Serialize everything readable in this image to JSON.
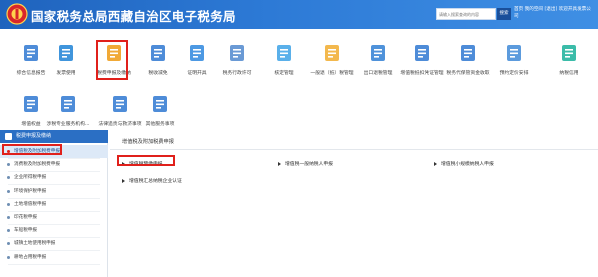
{
  "header": {
    "title": "国家税务总局西藏自治区电子税务局",
    "search_placeholder": "请输入搜索查询的内容",
    "search_button": "搜索",
    "links": "首页  我的空间  [退出]  欢迎开具发票公司"
  },
  "colors": {
    "header_bg": "#2470cc",
    "accent": "#2b6fc4",
    "highlight": "#e0201b"
  },
  "toolbar": {
    "items": [
      {
        "label": "综合信息报告",
        "icon": "info-report-icon",
        "color": "#3b7fd4"
      },
      {
        "label": "发票使用",
        "icon": "invoice-use-icon",
        "color": "#2b8ad8"
      },
      {
        "label": "税费申报及缴纳",
        "icon": "tax-filing-icon",
        "color": "#f0a020"
      },
      {
        "label": "税收减免",
        "icon": "tax-reduction-icon",
        "color": "#3b7fd4"
      },
      {
        "label": "证明开具",
        "icon": "certificate-icon",
        "color": "#3a8ee0"
      },
      {
        "label": "税务行政许可",
        "icon": "admin-license-icon",
        "color": "#5a8fd0"
      },
      {
        "label": "核定管理",
        "icon": "assessment-icon",
        "color": "#48a7e8"
      },
      {
        "label": "一般退（抵）税管理",
        "icon": "tax-refund-icon",
        "color": "#f2b03a"
      },
      {
        "label": "出口退税管理",
        "icon": "export-refund-icon",
        "color": "#3c86d6"
      },
      {
        "label": "增值税抵扣凭证管理",
        "icon": "vat-deduction-icon",
        "color": "#3b7fd4"
      },
      {
        "label": "税务代保管资金收取",
        "icon": "custody-fund-icon",
        "color": "#3b7fd4"
      },
      {
        "label": "预约定价安排",
        "icon": "pricing-icon",
        "color": "#4a90d9"
      },
      {
        "label": "纳税信用",
        "icon": "credit-icon",
        "color": "#26b5a0"
      },
      {
        "label": "增值权益",
        "icon": "shield-icon",
        "color": "#3b7fd4"
      },
      {
        "label": "涉税专业服务机构...",
        "icon": "service-agency-icon",
        "color": "#3b7fd4"
      },
      {
        "label": "法律追责与救济事项",
        "icon": "legal-icon",
        "color": "#3b7fd4"
      },
      {
        "label": "其他服务事项",
        "icon": "handshake-icon",
        "color": "#3b7fd4"
      }
    ]
  },
  "sidebar": {
    "title": "税费申报及缴纳",
    "items": [
      {
        "label": "增值税及附加税费申报",
        "active": true
      },
      {
        "label": "消费税及附加税费申报",
        "active": false
      },
      {
        "label": "企业所得税申报",
        "active": false
      },
      {
        "label": "环境保护税申报",
        "active": false
      },
      {
        "label": "土地增值税申报",
        "active": false
      },
      {
        "label": "印花税申报",
        "active": false
      },
      {
        "label": "车船税申报",
        "active": false
      },
      {
        "label": "城镇土地使用税申报",
        "active": false
      },
      {
        "label": "耕地占用税申报",
        "active": false
      }
    ]
  },
  "main": {
    "title": "增值税及附加税费申报",
    "forms": [
      {
        "label": "增值税预缴申报"
      },
      {
        "label": "增值税一般纳税人申报"
      },
      {
        "label": "增值税小规模纳税人申报"
      },
      {
        "label": "增值税汇总纳税企业认证"
      }
    ]
  }
}
